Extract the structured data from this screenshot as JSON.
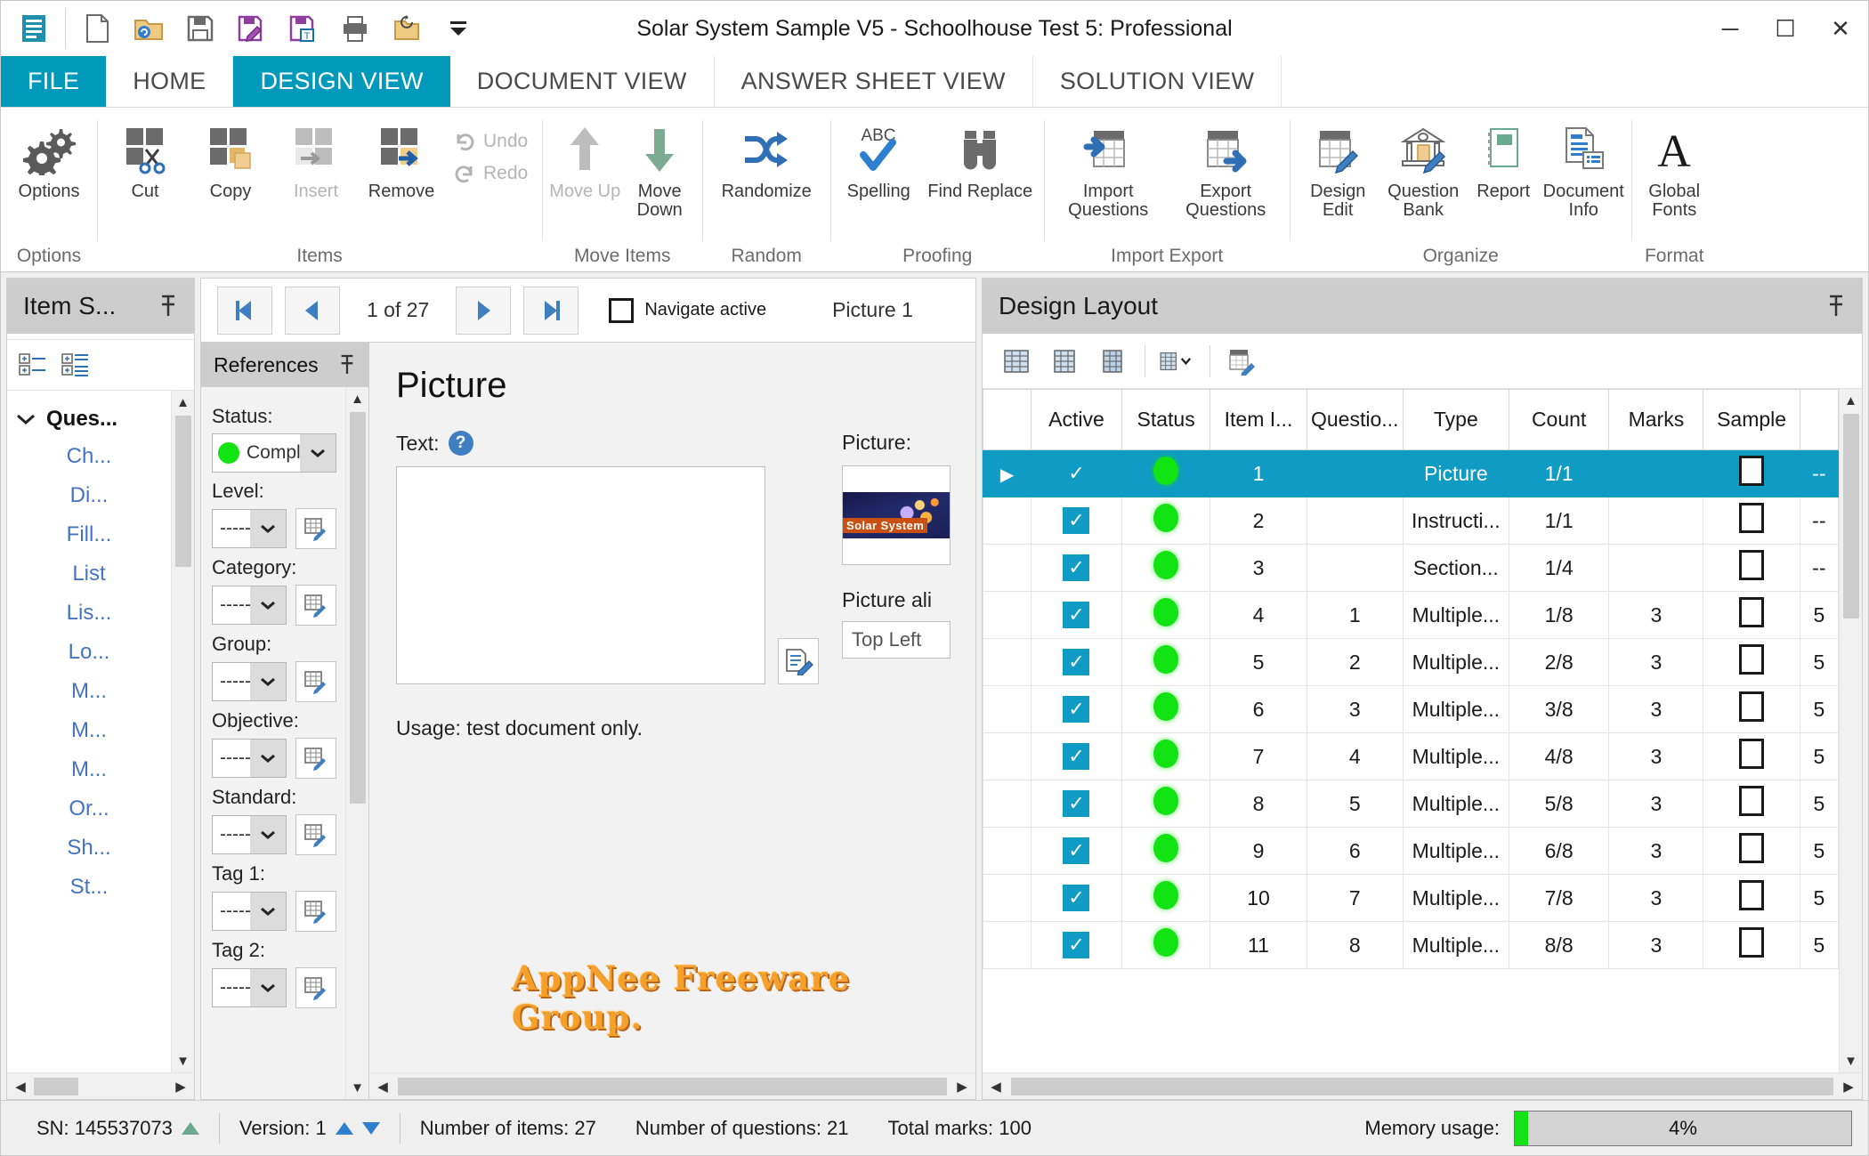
{
  "window": {
    "title": "Solar System Sample V5 - Schoolhouse Test 5: Professional",
    "minimize": "─",
    "maximize": "☐",
    "close": "✕"
  },
  "quick_access": [
    {
      "name": "app-menu-icon",
      "label": "App Menu"
    },
    {
      "name": "new-document-icon",
      "label": "New"
    },
    {
      "name": "open-folder-icon",
      "label": "Open"
    },
    {
      "name": "save-icon",
      "label": "Save"
    },
    {
      "name": "save-edit-icon",
      "label": "Save As"
    },
    {
      "name": "save-template-icon",
      "label": "Save Template"
    },
    {
      "name": "print-icon",
      "label": "Print"
    },
    {
      "name": "recent-folder-icon",
      "label": "Recent"
    },
    {
      "name": "customize-qat-icon",
      "label": "Customize Quick Access Toolbar"
    }
  ],
  "tabs": [
    {
      "label": "FILE",
      "kind": "file"
    },
    {
      "label": "HOME",
      "kind": "normal"
    },
    {
      "label": "DESIGN VIEW",
      "kind": "active"
    },
    {
      "label": "DOCUMENT VIEW",
      "kind": "normal"
    },
    {
      "label": "ANSWER SHEET VIEW",
      "kind": "normal"
    },
    {
      "label": "SOLUTION VIEW",
      "kind": "normal"
    }
  ],
  "ribbon": {
    "groups": [
      {
        "label": "Options",
        "buttons": [
          {
            "label": "Options",
            "icon": "gears-icon",
            "enabled": true
          }
        ],
        "stack": []
      },
      {
        "label": "Items",
        "buttons": [
          {
            "label": "Cut",
            "icon": "scissors-icon",
            "enabled": true
          },
          {
            "label": "Copy",
            "icon": "copy-icon",
            "enabled": true
          },
          {
            "label": "Insert",
            "icon": "insert-icon",
            "enabled": false
          },
          {
            "label": "Remove",
            "icon": "remove-icon",
            "enabled": true
          }
        ],
        "stack": [
          {
            "label": "Undo",
            "icon": "undo-icon",
            "enabled": false
          },
          {
            "label": "Redo",
            "icon": "redo-icon",
            "enabled": false
          }
        ]
      },
      {
        "label": "Move Items",
        "buttons": [
          {
            "label": "Move Up",
            "icon": "arrow-up-icon",
            "enabled": false
          },
          {
            "label": "Move Down",
            "icon": "arrow-down-icon",
            "enabled": true
          }
        ],
        "stack": []
      },
      {
        "label": "Random",
        "buttons": [
          {
            "label": "Randomize",
            "icon": "shuffle-icon",
            "enabled": true
          }
        ],
        "stack": []
      },
      {
        "label": "Proofing",
        "buttons": [
          {
            "label": "Spelling",
            "icon": "spellcheck-icon",
            "enabled": true
          },
          {
            "label": "Find Replace",
            "icon": "binoculars-icon",
            "enabled": true
          }
        ],
        "stack": []
      },
      {
        "label": "Import Export",
        "buttons": [
          {
            "label": "Import Questions",
            "icon": "table-import-icon",
            "enabled": true
          },
          {
            "label": "Export Questions",
            "icon": "table-export-icon",
            "enabled": true
          }
        ],
        "stack": []
      },
      {
        "label": "Organize",
        "buttons": [
          {
            "label": "Design Edit",
            "icon": "table-edit-icon",
            "enabled": true
          },
          {
            "label": "Question Bank",
            "icon": "bank-edit-icon",
            "enabled": true
          },
          {
            "label": "Report",
            "icon": "notebook-icon",
            "enabled": true
          },
          {
            "label": "Document Info",
            "icon": "document-info-icon",
            "enabled": true
          }
        ],
        "stack": []
      },
      {
        "label": "Format",
        "buttons": [
          {
            "label": "Global Fonts",
            "icon": "font-a-icon",
            "enabled": true
          }
        ],
        "stack": []
      }
    ]
  },
  "item_selector": {
    "title": "Item S...",
    "pin_icon": "pin-icon",
    "toolbar": [
      {
        "name": "expand-collapse-list-icon"
      },
      {
        "name": "expand-collapse-detail-icon"
      }
    ],
    "group": {
      "label": "Ques...",
      "expanded": true
    },
    "items": [
      "Ch...",
      "Di...",
      "Fill...",
      "List",
      "Lis...",
      "Lo...",
      "M...",
      "M...",
      "M...",
      "Or...",
      "Sh...",
      "St..."
    ]
  },
  "navigation": {
    "first_label": "❙◀",
    "prev_label": "◀",
    "position": "1 of 27",
    "next_label": "▶",
    "last_label": "▶❙",
    "navigate_active_label": "Navigate active",
    "navigate_active_checked": false,
    "current_item_label": "Picture  1"
  },
  "references": {
    "title": "References",
    "pin_icon": "pin-icon",
    "fields": [
      {
        "label": "Status:",
        "value": "Comple",
        "has_led": true,
        "has_edit": false
      },
      {
        "label": "Level:",
        "value": "------",
        "has_led": false,
        "has_edit": true
      },
      {
        "label": "Category:",
        "value": "------",
        "has_led": false,
        "has_edit": true
      },
      {
        "label": "Group:",
        "value": "------",
        "has_led": false,
        "has_edit": true
      },
      {
        "label": "Objective:",
        "value": "------",
        "has_led": false,
        "has_edit": true
      },
      {
        "label": "Standard:",
        "value": "------",
        "has_led": false,
        "has_edit": true
      },
      {
        "label": "Tag 1:",
        "value": "------",
        "has_led": false,
        "has_edit": true
      },
      {
        "label": "Tag 2:",
        "value": "------",
        "has_led": false,
        "has_edit": true
      }
    ]
  },
  "document": {
    "heading": "Picture",
    "text_label": "Text:",
    "text_help_icon": "help-icon",
    "text_value": "",
    "text_edit_icon": "edit-text-icon",
    "picture_label": "Picture:",
    "picture_caption": "Solar System",
    "picture_align_label": "Picture ali",
    "picture_align_value": "Top Left",
    "usage": "Usage: test document only.",
    "watermark": "AppNee Freeware Group."
  },
  "design_layout": {
    "title": "Design Layout",
    "pin_icon": "pin-icon",
    "toolbar": [
      {
        "name": "grid-view-all-icon"
      },
      {
        "name": "grid-view-compact-icon"
      },
      {
        "name": "grid-view-detail-icon"
      },
      {
        "name": "grid-view-dropdown-icon"
      },
      {
        "name": "grid-edit-icon"
      }
    ],
    "columns": [
      "",
      "Active",
      "Status",
      "Item I...",
      "Questio...",
      "Type",
      "Count",
      "Marks",
      "Sample",
      ""
    ],
    "rows": [
      {
        "selected": true,
        "active": true,
        "status": "green",
        "item_id": "1",
        "question_no": "",
        "type": "Picture",
        "count": "1/1",
        "marks": "",
        "sample": false,
        "last": "--"
      },
      {
        "selected": false,
        "active": true,
        "status": "green",
        "item_id": "2",
        "question_no": "",
        "type": "Instructi...",
        "count": "1/1",
        "marks": "",
        "sample": false,
        "last": "--"
      },
      {
        "selected": false,
        "active": true,
        "status": "green",
        "item_id": "3",
        "question_no": "",
        "type": "Section...",
        "count": "1/4",
        "marks": "",
        "sample": false,
        "last": "--"
      },
      {
        "selected": false,
        "active": true,
        "status": "green",
        "item_id": "4",
        "question_no": "1",
        "type": "Multiple...",
        "count": "1/8",
        "marks": "3",
        "sample": false,
        "last": "5"
      },
      {
        "selected": false,
        "active": true,
        "status": "green",
        "item_id": "5",
        "question_no": "2",
        "type": "Multiple...",
        "count": "2/8",
        "marks": "3",
        "sample": false,
        "last": "5"
      },
      {
        "selected": false,
        "active": true,
        "status": "green",
        "item_id": "6",
        "question_no": "3",
        "type": "Multiple...",
        "count": "3/8",
        "marks": "3",
        "sample": false,
        "last": "5"
      },
      {
        "selected": false,
        "active": true,
        "status": "green",
        "item_id": "7",
        "question_no": "4",
        "type": "Multiple...",
        "count": "4/8",
        "marks": "3",
        "sample": false,
        "last": "5"
      },
      {
        "selected": false,
        "active": true,
        "status": "green",
        "item_id": "8",
        "question_no": "5",
        "type": "Multiple...",
        "count": "5/8",
        "marks": "3",
        "sample": false,
        "last": "5"
      },
      {
        "selected": false,
        "active": true,
        "status": "green",
        "item_id": "9",
        "question_no": "6",
        "type": "Multiple...",
        "count": "6/8",
        "marks": "3",
        "sample": false,
        "last": "5"
      },
      {
        "selected": false,
        "active": true,
        "status": "green",
        "item_id": "10",
        "question_no": "7",
        "type": "Multiple...",
        "count": "7/8",
        "marks": "3",
        "sample": false,
        "last": "5"
      },
      {
        "selected": false,
        "active": true,
        "status": "green",
        "item_id": "11",
        "question_no": "8",
        "type": "Multiple...",
        "count": "8/8",
        "marks": "3",
        "sample": false,
        "last": "5"
      }
    ]
  },
  "statusbar": {
    "serial_label": "SN:  145537073",
    "version_label": "Version: 1",
    "items_label": "Number of items: 27",
    "questions_label": "Number of questions: 21",
    "marks_label": "Total marks: 100",
    "memory_label": "Memory usage:",
    "memory_value": "4%",
    "memory_percent": 4
  },
  "colors": {
    "accent": "#0099bc",
    "grid_select": "#0f9bc4",
    "status_green": "#12e312",
    "watermark": "#f5a02a"
  }
}
